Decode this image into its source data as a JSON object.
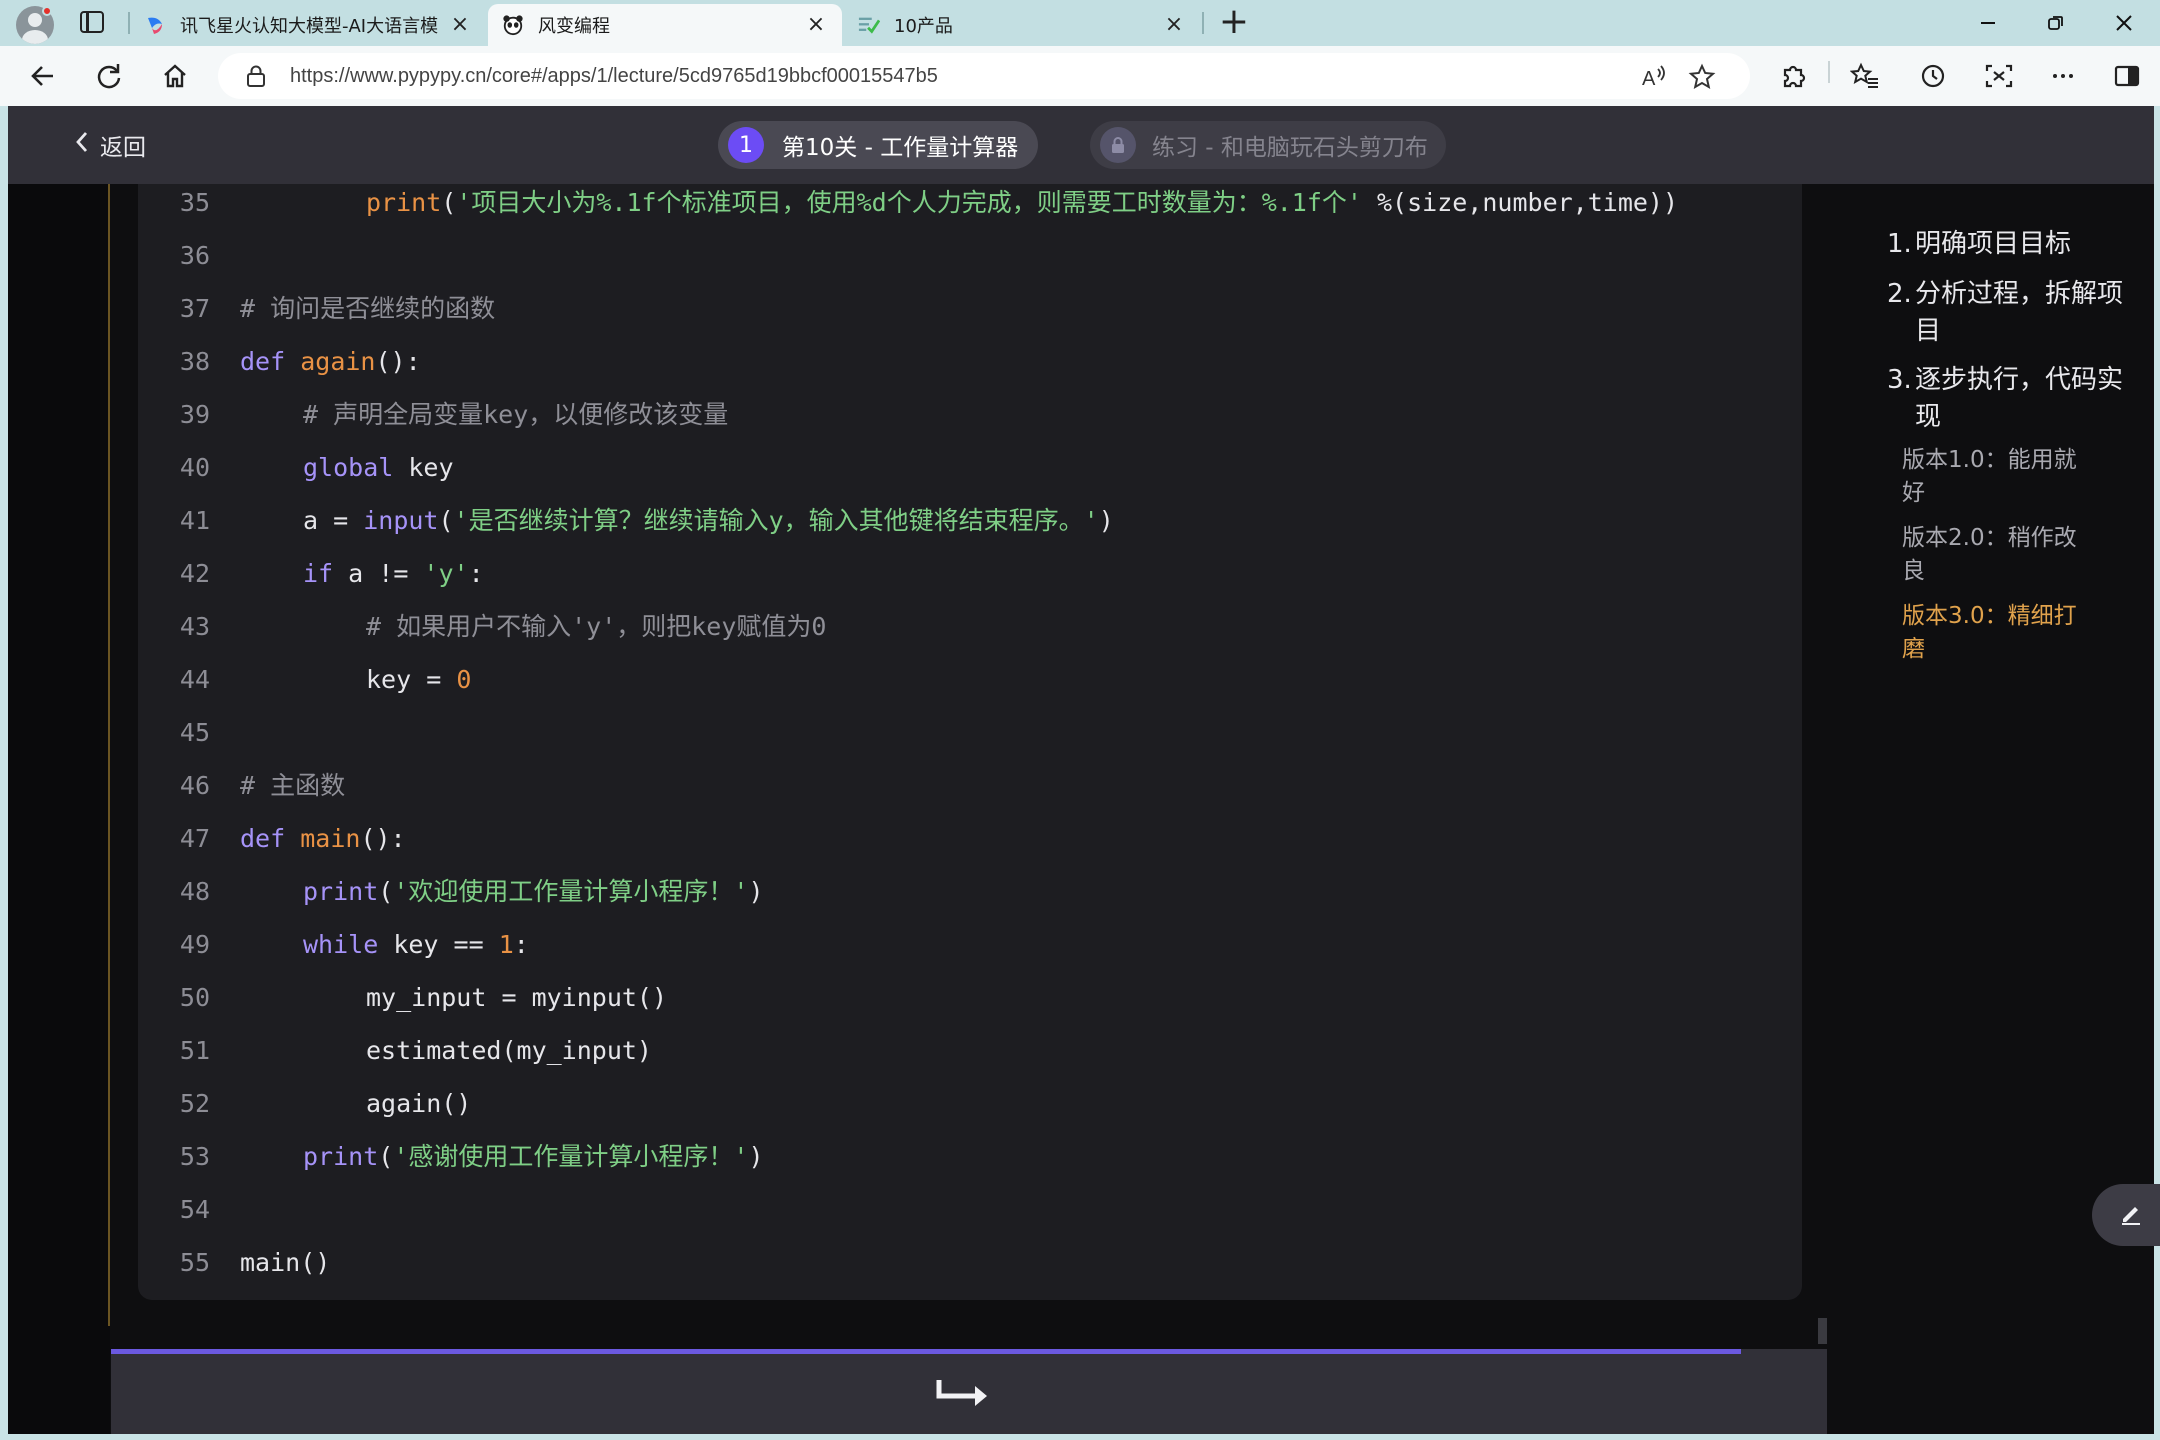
{
  "browser": {
    "tabs": [
      {
        "title": "讯飞星火认知大模型-AI大语言模",
        "active": false
      },
      {
        "title": "风变编程",
        "active": true
      },
      {
        "title": "10产品",
        "active": false
      }
    ],
    "url": "https://www.pypypy.cn/core#/apps/1/lecture/5cd9765d19bbcf00015547b5",
    "icons": {
      "profile": "profile-avatar-icon",
      "tab_actions": "tab-actions-icon",
      "new_tab": "plus-icon",
      "minimize": "minimize-icon",
      "restore": "restore-icon",
      "close": "close-icon",
      "back": "back-arrow-icon",
      "refresh": "refresh-icon",
      "home": "home-icon",
      "lock": "lock-icon",
      "read_aloud": "read-aloud-icon",
      "favorite": "star-icon",
      "extensions": "puzzle-icon",
      "favorites": "favorites-icon",
      "history": "history-icon",
      "screenshot": "screenshot-icon",
      "more": "ellipsis-icon",
      "sidebar": "sidebar-icon"
    }
  },
  "header": {
    "back_label": "返回",
    "level_number": "1",
    "level_title": "第10关 - 工作量计算器",
    "exercise_title": "练习 - 和电脑玩石头剪刀布"
  },
  "code": {
    "lines": [
      {
        "n": "35",
        "indent": 2,
        "tokens": [
          [
            "fn",
            "print"
          ],
          [
            "",
            "("
          ],
          [
            "str",
            "'项目大小为%.1f个标准项目，使用%d个人力完成，则需要工时数量为：%.1f个'"
          ],
          [
            "",
            " %(size,number,time))"
          ]
        ]
      },
      {
        "n": "36",
        "indent": 0,
        "tokens": []
      },
      {
        "n": "37",
        "indent": 0,
        "tokens": [
          [
            "cm",
            "# 询问是否继续的函数"
          ]
        ]
      },
      {
        "n": "38",
        "indent": 0,
        "tokens": [
          [
            "kw",
            "def"
          ],
          [
            "",
            " "
          ],
          [
            "fn",
            "again"
          ],
          [
            "",
            "():"
          ]
        ]
      },
      {
        "n": "39",
        "indent": 1,
        "tokens": [
          [
            "cm",
            "# 声明全局变量key，以便修改该变量"
          ]
        ]
      },
      {
        "n": "40",
        "indent": 1,
        "tokens": [
          [
            "kw",
            "global"
          ],
          [
            "",
            " key"
          ]
        ]
      },
      {
        "n": "41",
        "indent": 1,
        "tokens": [
          [
            "",
            "a = "
          ],
          [
            "kw",
            "input"
          ],
          [
            "",
            "("
          ],
          [
            "str",
            "'是否继续计算？继续请输入y，输入其他键将结束程序。'"
          ],
          [
            "",
            ")"
          ]
        ]
      },
      {
        "n": "42",
        "indent": 1,
        "tokens": [
          [
            "kw",
            "if"
          ],
          [
            "",
            " a != "
          ],
          [
            "str",
            "'y'"
          ],
          [
            "",
            ":"
          ]
        ]
      },
      {
        "n": "43",
        "indent": 2,
        "tokens": [
          [
            "cm",
            "# 如果用户不输入'y'，则把key赋值为0"
          ]
        ]
      },
      {
        "n": "44",
        "indent": 2,
        "tokens": [
          [
            "",
            "key = "
          ],
          [
            "num",
            "0"
          ]
        ]
      },
      {
        "n": "45",
        "indent": 0,
        "tokens": []
      },
      {
        "n": "46",
        "indent": 0,
        "tokens": [
          [
            "cm",
            "# 主函数"
          ]
        ]
      },
      {
        "n": "47",
        "indent": 0,
        "tokens": [
          [
            "kw",
            "def"
          ],
          [
            "",
            " "
          ],
          [
            "fn",
            "main"
          ],
          [
            "",
            "():"
          ]
        ]
      },
      {
        "n": "48",
        "indent": 1,
        "tokens": [
          [
            "kw",
            "print"
          ],
          [
            "",
            "("
          ],
          [
            "str",
            "'欢迎使用工作量计算小程序！'"
          ],
          [
            "",
            ")"
          ]
        ]
      },
      {
        "n": "49",
        "indent": 1,
        "tokens": [
          [
            "kw",
            "while"
          ],
          [
            "",
            " key == "
          ],
          [
            "num",
            "1"
          ],
          [
            "",
            ":"
          ]
        ]
      },
      {
        "n": "50",
        "indent": 2,
        "tokens": [
          [
            "",
            "my_input = myinput()"
          ]
        ]
      },
      {
        "n": "51",
        "indent": 2,
        "tokens": [
          [
            "",
            "estimated(my_input)"
          ]
        ]
      },
      {
        "n": "52",
        "indent": 2,
        "tokens": [
          [
            "",
            "again()"
          ]
        ]
      },
      {
        "n": "53",
        "indent": 1,
        "tokens": [
          [
            "kw",
            "print"
          ],
          [
            "",
            "("
          ],
          [
            "str",
            "'感谢使用工作量计算小程序！'"
          ],
          [
            "",
            ")"
          ]
        ]
      },
      {
        "n": "54",
        "indent": 0,
        "tokens": []
      },
      {
        "n": "55",
        "indent": 0,
        "tokens": [
          [
            "",
            "main()"
          ]
        ]
      }
    ]
  },
  "outline": {
    "items": [
      {
        "num": "1.",
        "label": "明确项目目标"
      },
      {
        "num": "2.",
        "label": "分析过程，拆解项目"
      },
      {
        "num": "3.",
        "label": "逐步执行，代码实现"
      }
    ],
    "sub_items": [
      {
        "label": "版本1.0：能用就好",
        "active": false
      },
      {
        "label": "版本2.0：稍作改良",
        "active": false
      },
      {
        "label": "版本3.0：精细打磨",
        "active": true
      }
    ]
  },
  "colors": {
    "accent": "#6c4cf5",
    "keyword": "#a693f8",
    "function": "#e99245",
    "string": "#7fcf86",
    "comment": "#8f8f97",
    "active_outline": "#e0a24c"
  }
}
